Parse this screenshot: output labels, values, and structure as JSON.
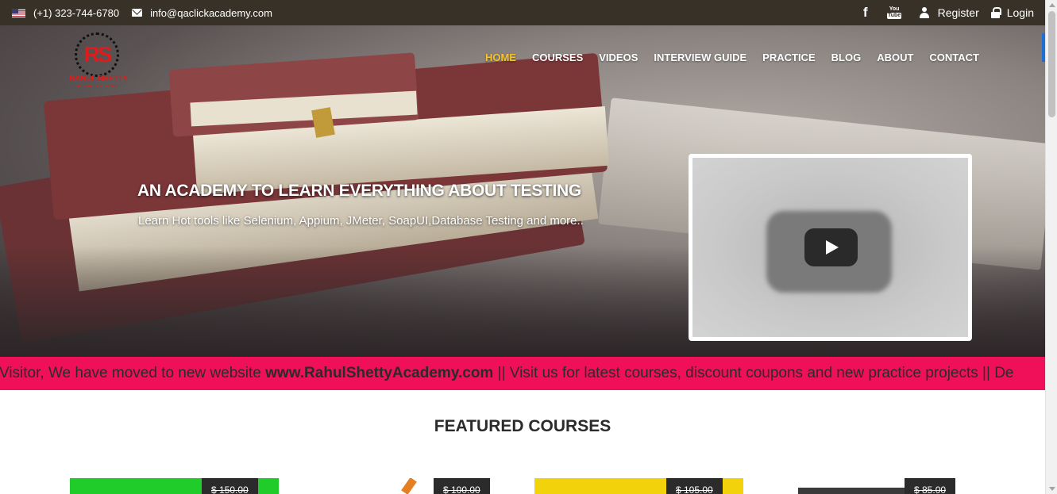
{
  "topbar": {
    "phone": "(+1) 323-744-6780",
    "email": "info@qaclickacademy.com",
    "register": "Register",
    "login": "Login"
  },
  "logo": {
    "initials": "RS",
    "name": "RAHUL SHETTY",
    "tagline": "BECOME TEST EXPERT"
  },
  "nav": {
    "items": [
      "HOME",
      "COURSES",
      "VIDEOS",
      "INTERVIEW GUIDE",
      "PRACTICE",
      "BLOG",
      "ABOUT",
      "CONTACT"
    ],
    "active": "HOME",
    "active_color": "#f5c22b"
  },
  "hero": {
    "headline": "AN ACADEMY TO LEARN EVERYTHING ABOUT TESTING",
    "subline": "Learn Hot tools like Selenium, Appium, JMeter, SoapUI,Database Testing and more.."
  },
  "marquee": {
    "text_before": "Visitor, We have moved to new website ",
    "link": "www.RahulShettyAcademy.com",
    "text_after": " || Visit us for latest courses, discount coupons and new practice projects || De",
    "bg_color": "#f0105a"
  },
  "featured": {
    "title": "FEATURED COURSES",
    "courses": [
      {
        "price": "$ 150.00",
        "accent": "#1fcc2a"
      },
      {
        "price": "$ 100.00",
        "accent": "#ffffff"
      },
      {
        "price": "$ 105.00",
        "accent": "#f1d20b"
      },
      {
        "price": "$ 85.00",
        "accent": "#ffffff"
      }
    ]
  },
  "icons": [
    "us-flag-icon",
    "mail-icon",
    "facebook-icon",
    "youtube-icon",
    "user-icon",
    "lock-icon",
    "play-icon"
  ]
}
